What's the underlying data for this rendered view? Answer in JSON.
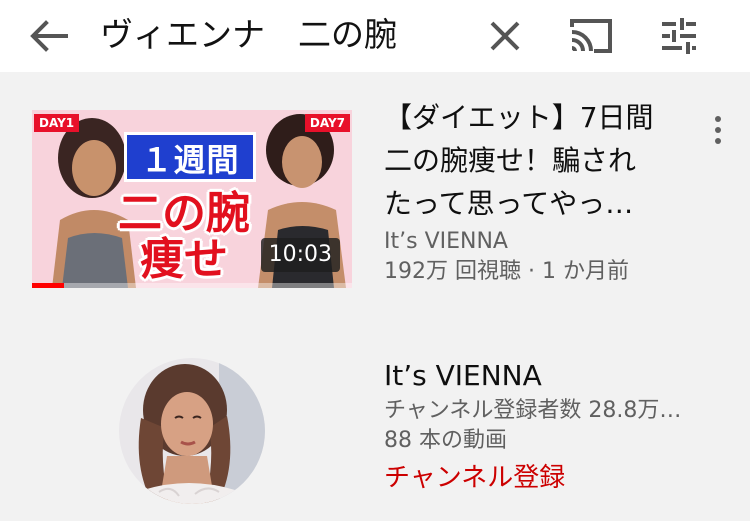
{
  "header": {
    "search_query": "ヴィエンナ　二の腕",
    "back_icon": "arrow-left-icon",
    "clear_icon": "close-icon",
    "cast_icon": "cast-icon",
    "filter_icon": "tune-icon"
  },
  "video": {
    "thumbnail": {
      "badge_left": "DAY1",
      "badge_right": "DAY7",
      "week_text": "１週間",
      "line1": "二の腕",
      "line2": "痩せ",
      "duration": "10:03",
      "watched_fraction": 0.1
    },
    "title_lines": [
      "【ダイエット】7日間",
      "二の腕痩せ！騙され",
      "たって思ってやっ…"
    ],
    "channel": "It’s VIENNA",
    "meta": "192万 回視聴 · 1 か月前",
    "menu_icon": "more-vert-icon"
  },
  "channel": {
    "name": "It’s VIENNA",
    "subscribers": "チャンネル登録者数 28.8万…",
    "videos": "88 本の動画",
    "subscribe_label": "チャンネル登録"
  },
  "colors": {
    "background": "#f2f2f2",
    "topbar": "#ffffff",
    "secondary_text": "#606060",
    "subscribe_red": "#cc0000"
  }
}
